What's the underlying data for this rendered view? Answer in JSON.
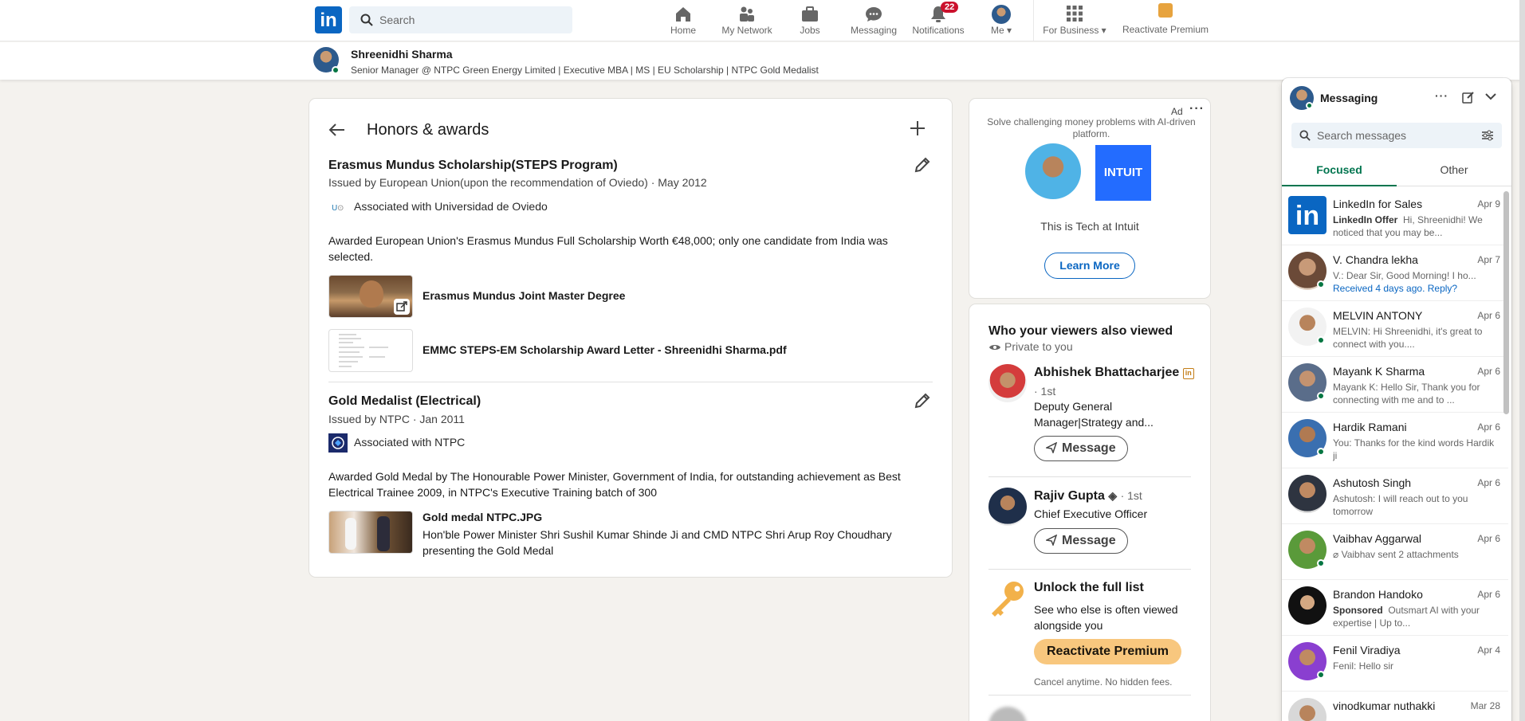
{
  "nav": {
    "search_placeholder": "Search",
    "items": [
      {
        "label": "Home",
        "icon": "home-icon"
      },
      {
        "label": "My Network",
        "icon": "network-icon"
      },
      {
        "label": "Jobs",
        "icon": "jobs-icon"
      },
      {
        "label": "Messaging",
        "icon": "messaging-icon"
      },
      {
        "label": "Notifications",
        "icon": "bell-icon",
        "badge": "22"
      },
      {
        "label": "Me",
        "icon": "avatar"
      },
      {
        "label": "For Business",
        "icon": "grid-icon"
      },
      {
        "label": "Reactivate Premium",
        "icon": "premium-icon"
      }
    ]
  },
  "profile_bar": {
    "name": "Shreenidhi Sharma",
    "headline": "Senior Manager @ NTPC Green Energy Limited | Executive MBA | MS | EU Scholarship | NTPC Gold Medalist"
  },
  "honors": {
    "title": "Honors & awards",
    "awards": [
      {
        "title": "Erasmus Mundus Scholarship(STEPS Program)",
        "issuer": "Issued by European Union(upon the recommendation of Oviedo) · May 2012",
        "associated": "Associated with Universidad de Oviedo",
        "description": "Awarded European Union's Erasmus Mundus Full Scholarship Worth €48,000; only one candidate from India was selected.",
        "media": [
          {
            "title": "Erasmus Mundus Joint Master Degree"
          },
          {
            "title": "EMMC STEPS-EM Scholarship Award Letter - Shreenidhi Sharma.pdf"
          }
        ]
      },
      {
        "title": "Gold Medalist (Electrical)",
        "issuer": "Issued by NTPC · Jan 2011",
        "associated": "Associated with NTPC",
        "description": "Awarded Gold Medal by The Honourable Power Minister, Government of India, for outstanding achievement as Best Electrical Trainee 2009, in NTPC's Executive Training batch of 300",
        "media": [
          {
            "title": "Gold medal NTPC.JPG",
            "description": "Hon'ble Power Minister Shri Sushil Kumar Shinde Ji and CMD NTPC Shri Arup Roy Choudhary presenting the Gold Medal"
          }
        ]
      }
    ]
  },
  "ad": {
    "label": "Ad",
    "text": "Solve challenging money problems with AI-driven platform.",
    "brand": "INTUIT",
    "tagline": "This is Tech at Intuit",
    "cta": "Learn More"
  },
  "viewers": {
    "title": "Who your viewers also viewed",
    "private": "Private to you",
    "people": [
      {
        "name": "Abhishek Bhattacharjee",
        "degree": "· 1st",
        "headline": "Deputy General Manager|Strategy and...",
        "button": "Message"
      },
      {
        "name": "Rajiv Gupta",
        "degree": "· 1st",
        "headline": "Chief Executive Officer",
        "button": "Message"
      }
    ],
    "unlock_title": "Unlock the full list",
    "unlock_text": "See who else is often viewed alongside you",
    "unlock_button": "Reactivate Premium",
    "cancel_text": "Cancel anytime. No hidden fees."
  },
  "messaging": {
    "title": "Messaging",
    "search_placeholder": "Search messages",
    "tabs": [
      "Focused",
      "Other"
    ],
    "conversations": [
      {
        "name": "LinkedIn for Sales",
        "date": "Apr 9",
        "prefix": "LinkedIn Offer",
        "preview": "Hi, Shreenidhi! We noticed that you may be..."
      },
      {
        "name": "V. Chandra lekha",
        "date": "Apr 7",
        "preview": "V.: Dear Sir, Good Morning! I ho...",
        "extra": "Received 4 days ago. Reply?"
      },
      {
        "name": "MELVIN ANTONY",
        "date": "Apr 6",
        "preview": "MELVIN: Hi Shreenidhi, it's great to connect with you...."
      },
      {
        "name": "Mayank K Sharma",
        "date": "Apr 6",
        "preview": "Mayank K: Hello Sir, Thank you for connecting with me and to ..."
      },
      {
        "name": "Hardik Ramani",
        "date": "Apr 6",
        "preview": "You: Thanks for the kind words Hardik ji"
      },
      {
        "name": "Ashutosh Singh",
        "date": "Apr 6",
        "preview": "Ashutosh: I will reach out to you tomorrow"
      },
      {
        "name": "Vaibhav Aggarwal",
        "date": "Apr 6",
        "preview": "Vaibhav sent 2 attachments"
      },
      {
        "name": "Brandon Handoko",
        "date": "Apr 6",
        "prefix": "Sponsored",
        "preview": "Outsmart AI with your expertise | Up to..."
      },
      {
        "name": "Fenil Viradiya",
        "date": "Apr 4",
        "preview": "Fenil: Hello sir"
      },
      {
        "name": "vinodkumar nuthakki",
        "date": "Mar 28",
        "preview": ""
      }
    ]
  },
  "colors": {
    "brand": "#0a66c2",
    "accent_green": "#01754f",
    "premium": "#f8c77e",
    "badge": "#cb112d"
  }
}
